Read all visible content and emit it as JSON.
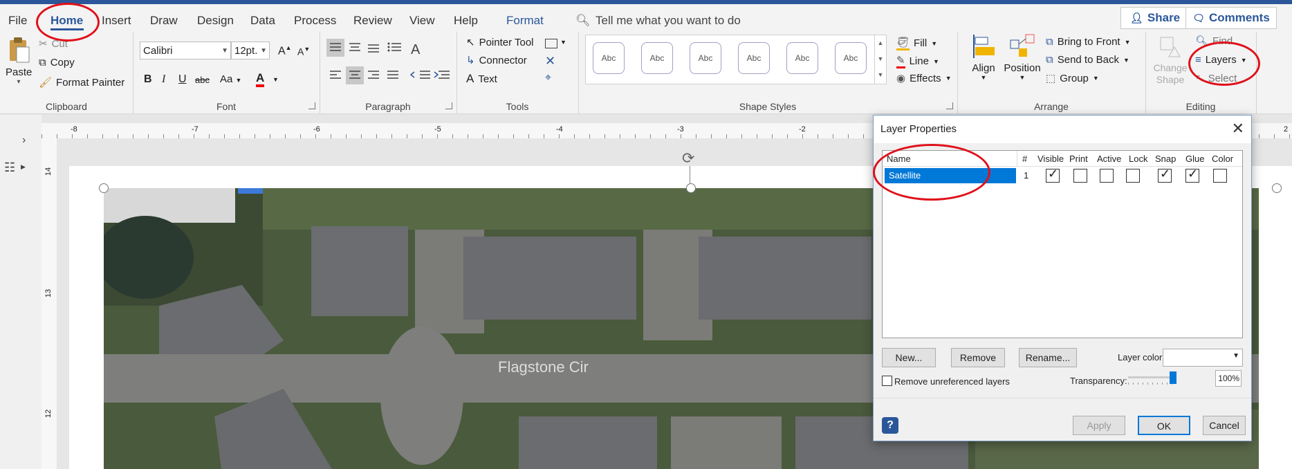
{
  "tabs": [
    "File",
    "Home",
    "Insert",
    "Draw",
    "Design",
    "Data",
    "Process",
    "Review",
    "View",
    "Help",
    "Format"
  ],
  "tell_me": "Tell me what you want to do",
  "share_label": "Share",
  "comments_label": "Comments",
  "clipboard": {
    "paste": "Paste",
    "cut": "Cut",
    "copy": "Copy",
    "format_painter": "Format Painter",
    "label": "Clipboard"
  },
  "font": {
    "name": "Calibri",
    "size": "12pt.",
    "grow": "A",
    "shrink": "A",
    "bold": "B",
    "italic": "I",
    "underline": "U",
    "strike": "abc",
    "case": "Aa",
    "color": "A",
    "label": "Font"
  },
  "paragraph": {
    "label": "Paragraph"
  },
  "tools": {
    "pointer": "Pointer Tool",
    "connector": "Connector",
    "text": "Text",
    "label": "Tools"
  },
  "shape_styles": {
    "swatch": "Abc",
    "fill": "Fill",
    "line": "Line",
    "effects": "Effects",
    "label": "Shape Styles"
  },
  "arrange": {
    "align": "Align",
    "position": "Position",
    "bring_front": "Bring to Front",
    "send_back": "Send to Back",
    "group": "Group",
    "label": "Arrange"
  },
  "editing": {
    "change_shape": "Change Shape",
    "find": "Find",
    "layers": "Layers",
    "select": "Select",
    "label": "Editing"
  },
  "ruler": {
    "h": [
      "-8",
      "-7",
      "-6",
      "-5",
      "-4",
      "-3",
      "-2",
      "2"
    ],
    "v": [
      "14",
      "13",
      "12"
    ]
  },
  "map_label": "Flagstone Cir",
  "dialog": {
    "title": "Layer Properties",
    "columns": [
      "Name",
      "#",
      "Visible",
      "Print",
      "Active",
      "Lock",
      "Snap",
      "Glue",
      "Color"
    ],
    "rows": [
      {
        "name": "Satellite",
        "num": "1",
        "visible": true,
        "print": false,
        "active": false,
        "lock": false,
        "snap": true,
        "glue": true,
        "color": false
      }
    ],
    "new": "New...",
    "remove": "Remove",
    "rename": "Rename...",
    "layer_color_label": "Layer color:",
    "remove_unref": "Remove unreferenced layers",
    "transparency_label": "Transparency:",
    "transparency_value": "100%",
    "apply": "Apply",
    "ok": "OK",
    "cancel": "Cancel"
  },
  "colors": {
    "accent": "#2b579a",
    "selection": "#0078d7",
    "annotation": "#e0101a"
  }
}
